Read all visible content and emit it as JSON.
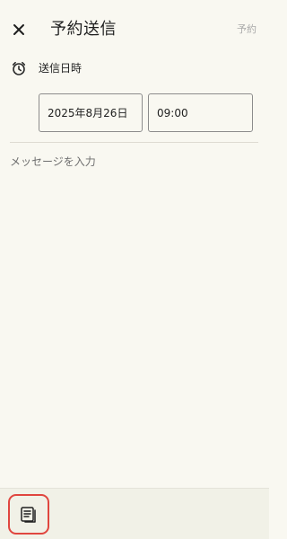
{
  "header": {
    "close_icon": "close-icon",
    "title": "予約送信",
    "action_label": "予約"
  },
  "schedule": {
    "icon": "alarm-clock-icon",
    "label": "送信日時",
    "date": "2025年8月26日",
    "time": "09:00"
  },
  "message": {
    "value": "",
    "placeholder": "メッセージを入力"
  },
  "toolbar": {
    "template_icon": "template-documents-icon",
    "highlight_color": "#e0463f"
  }
}
